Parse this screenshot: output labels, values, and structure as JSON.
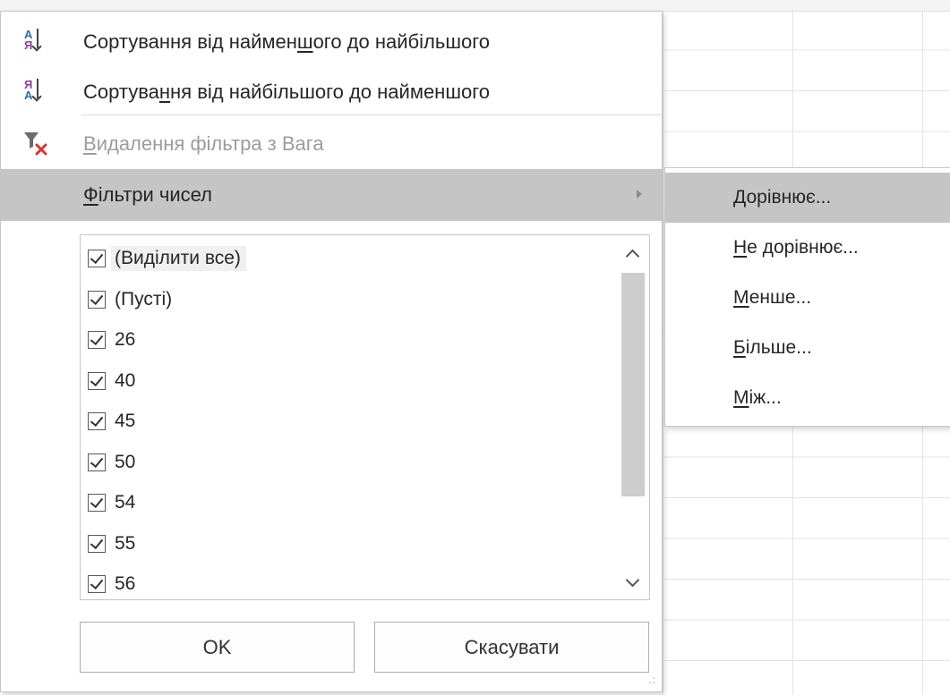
{
  "menu": {
    "sort_asc": {
      "pre": "Сортування від наймен",
      "key": "ш",
      "post": "ого до найбільшого",
      "icon": "sort-ascending-icon",
      "icon_top": "А",
      "icon_bottom": "Я"
    },
    "sort_desc": {
      "pre": "Сортува",
      "key": "н",
      "post": "ня від найбільшого до найменшого",
      "icon": "sort-descending-icon",
      "icon_top": "Я",
      "icon_bottom": "А"
    },
    "clear_filter": {
      "key": "В",
      "post": "идалення фільтра з Вага",
      "icon": "clear-filter-icon"
    },
    "number_filters": {
      "key": "Ф",
      "post": "ільтри чисел"
    }
  },
  "checklist": {
    "items": [
      {
        "label": "(Виділити все)",
        "checked": true
      },
      {
        "label": "(Пусті)",
        "checked": true
      },
      {
        "label": "26",
        "checked": true
      },
      {
        "label": "40",
        "checked": true
      },
      {
        "label": "45",
        "checked": true
      },
      {
        "label": "50",
        "checked": true
      },
      {
        "label": "54",
        "checked": true
      },
      {
        "label": "55",
        "checked": true
      },
      {
        "label": "56",
        "checked": true
      }
    ]
  },
  "buttons": {
    "ok": "OK",
    "cancel": "Скасувати"
  },
  "submenu": {
    "items": [
      {
        "key": "Д",
        "post": "орівнює..."
      },
      {
        "key": "Н",
        "post": "е дорівнює..."
      },
      {
        "key": "М",
        "post": "енше..."
      },
      {
        "key": "Б",
        "post": "ільше..."
      },
      {
        "key": "М",
        "post": "іж..."
      }
    ]
  },
  "colors": {
    "highlight": "#c5c5c5",
    "filter_x": "#d9342b",
    "sort_top_letter": "#2b6cb0",
    "sort_bottom_letter": "#8b3fa6"
  }
}
